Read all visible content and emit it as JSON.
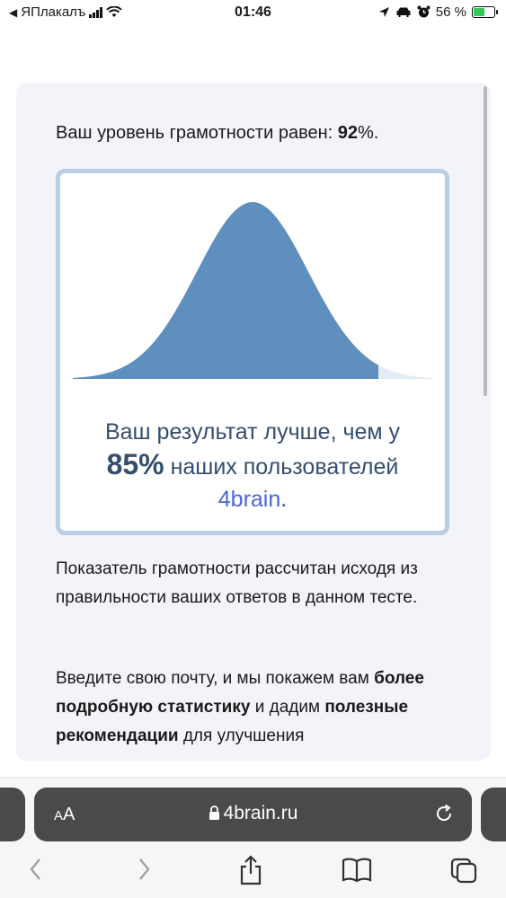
{
  "status_bar": {
    "back_app": "ЯПлакалъ",
    "time": "01:46",
    "battery_text": "56 %",
    "battery_level": 0.56
  },
  "card": {
    "score_prefix": "Ваш уровень грамотности равен: ",
    "score_value": "92",
    "score_suffix": "%.",
    "result_line1": "Ваш результат лучше, чем у",
    "result_percent": "85%",
    "result_line2": " наших пользователей",
    "result_brand": "4brain",
    "result_end": ".",
    "percentile": 0.85,
    "paragraph1": "Показатель грамотности рассчитан исходя из правильности ваших ответов в данном тесте.",
    "p2_part1": "Введите свою почту, и мы покажем вам ",
    "p2_bold1": "более подробную статистику",
    "p2_part2": " и дадим ",
    "p2_bold2": "полезные рекомендации",
    "p2_part3": " для улучшения"
  },
  "browser": {
    "aa_small": "A",
    "aa_large": "A",
    "url": "4brain.ru"
  },
  "colors": {
    "curve_fill": "#5e8fbe",
    "curve_rest": "#e4ebf5",
    "box_border": "#b9cfe3",
    "result_text": "#334e6e",
    "brand_link": "#4a66d8"
  },
  "icons": [
    "back-arrow-icon",
    "signal-icon",
    "wifi-icon",
    "location-icon",
    "car-icon",
    "alarm-icon",
    "battery-icon",
    "lock-icon",
    "reload-icon",
    "back-icon",
    "forward-icon",
    "share-icon",
    "bookmarks-icon",
    "tabs-icon"
  ]
}
